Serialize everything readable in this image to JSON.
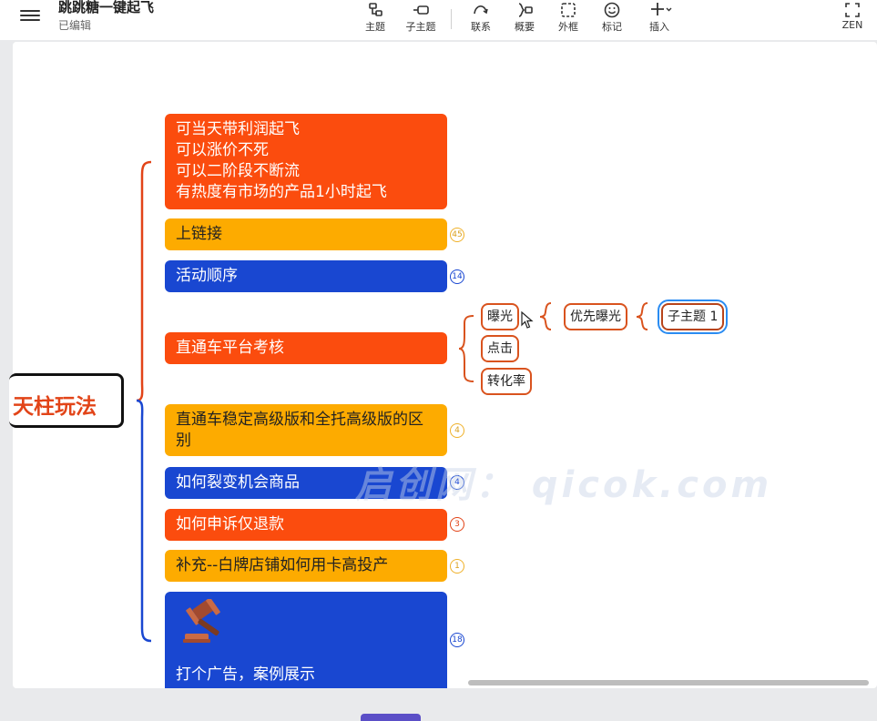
{
  "header": {
    "title": "跳跳糖一键起飞",
    "status": "已编辑"
  },
  "toolbar": {
    "topic": "主题",
    "subtopic": "子主题",
    "relation": "联系",
    "summary": "概要",
    "boundary": "外框",
    "marker": "标记",
    "insert": "插入",
    "zen": "ZEN"
  },
  "mindmap": {
    "root": "天柱玩法",
    "topics": [
      {
        "lines": [
          "可当天带利润起飞",
          "可以涨价不死",
          "可以二阶段不断流",
          "有热度有市场的产品1小时起飞"
        ]
      },
      {
        "label": "上链接",
        "count": "45"
      },
      {
        "label": "活动顺序",
        "count": "14"
      },
      {
        "label": "直通车平台考核"
      },
      {
        "lines": [
          "直通车稳定高级版和全托高级版的区",
          "别"
        ],
        "count": "4"
      },
      {
        "label": "如何裂变机会商品",
        "count": "4"
      },
      {
        "label": "如何申诉仅退款",
        "count": "3"
      },
      {
        "label": "补充--白牌店铺如何用卡高投产",
        "count": "1"
      },
      {
        "label": "打个广告，案例展示",
        "count": "18"
      }
    ],
    "subtopics": {
      "exposure": "曝光",
      "click": "点击",
      "conversion": "转化率",
      "priority_exposure": "优先曝光",
      "subtopic1": "子主题 1"
    }
  },
  "watermark": "启创网： qicok.com",
  "colors": {
    "orange": "#fb4c0e",
    "yellow": "#fdab00",
    "blue": "#1947d1",
    "root_text": "#e24418",
    "selection": "#2a8cf2"
  }
}
